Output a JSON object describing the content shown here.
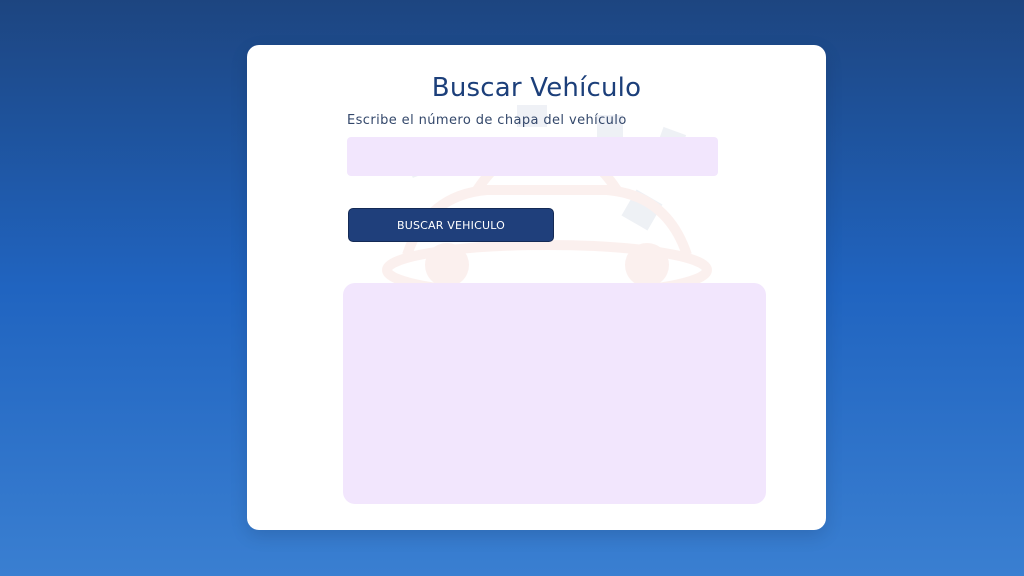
{
  "page": {
    "title": "Buscar Vehículo"
  },
  "search": {
    "label": "Escribe el número de chapa del vehículo",
    "input_value": "",
    "placeholder": "",
    "button_label": "BUSCAR VEHICULO"
  },
  "results": {
    "content": ""
  },
  "colors": {
    "background_top": "#1d4580",
    "background_bottom": "#3a7fd1",
    "card": "#ffffff",
    "title": "#1c3f7a",
    "field_fill": "#f2e6fd",
    "button": "#1f3f7b"
  },
  "icons": {
    "watermark": "car-gear-icon"
  }
}
